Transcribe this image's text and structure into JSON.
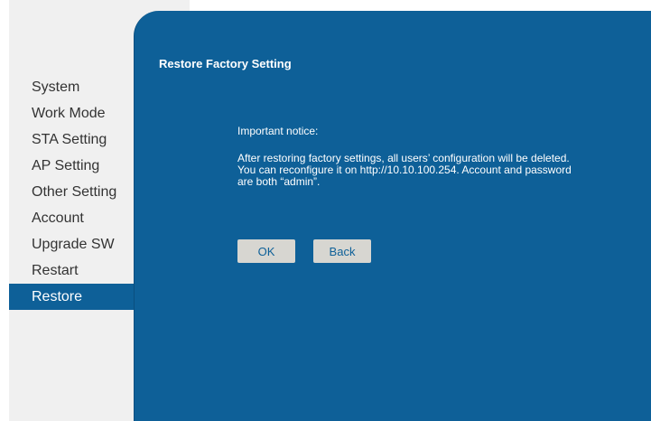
{
  "sidebar": {
    "items": [
      {
        "label": "System"
      },
      {
        "label": "Work Mode"
      },
      {
        "label": "STA Setting"
      },
      {
        "label": "AP Setting"
      },
      {
        "label": "Other Setting"
      },
      {
        "label": "Account"
      },
      {
        "label": "Upgrade SW"
      },
      {
        "label": "Restart"
      },
      {
        "label": "Restore"
      }
    ],
    "active_index": 8
  },
  "main": {
    "title": "Restore Factory Setting",
    "notice_heading": "Important notice:",
    "notice_body": "After restoring factory settings, all users’ configuration will be deleted. You can reconfigure it on http://10.10.100.254. Account and password are both “admin”.",
    "ok_label": "OK",
    "back_label": "Back"
  },
  "colors": {
    "panel_bg": "#0e6098",
    "sidebar_bg": "#f0f0f0",
    "button_bg": "#d7d6d1",
    "button_text": "#0e6098"
  }
}
